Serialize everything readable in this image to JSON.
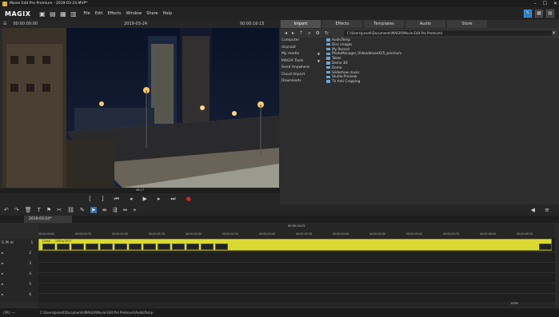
{
  "titlebar": {
    "title": "Movie Edit Pro Premium - 2019-03-24.MVP*",
    "minimize": "–",
    "maximize": "☐",
    "close": "✕"
  },
  "menubar": {
    "logo": "MAGIX",
    "menus": [
      "File",
      "Edit",
      "Effects",
      "Window",
      "Share",
      "Help"
    ]
  },
  "preview": {
    "timecode_left": "00:00:00:00",
    "title": "2019-03-24",
    "timecode_right": "00:00:16:15",
    "scrub_time": "06:17"
  },
  "media_pool": {
    "tabs": [
      "Import",
      "Effects",
      "Templates",
      "Audio",
      "Store"
    ],
    "path": "C:\\Users\\pnasti\\Documents\\MAGIX\\Movie Edit Pro Premium\\",
    "side_items": [
      {
        "label": "Computer",
        "chevron": false
      },
      {
        "label": "dcpnast",
        "chevron": false
      },
      {
        "label": "My media",
        "chevron": true
      },
      {
        "label": "MAGIX Tools",
        "chevron": true
      },
      {
        "label": "Send Anywhere",
        "chevron": false
      },
      {
        "label": "Cloud Import",
        "chevron": false
      },
      {
        "label": "Downloads",
        "chevron": false
      }
    ],
    "files": [
      "AudioTemp",
      "Disc images",
      "My Record",
      "PhotoManager_VideodeluxeX25_premium",
      "Takes",
      "Demo 3D",
      "Demo",
      "Slideshow music",
      "Studio-Preview",
      "TV Anti Cropping"
    ]
  },
  "timeline": {
    "tab": "2019-03-24*",
    "ruler_center": "00:00:16:15",
    "ticks": [
      "00:00:00:00",
      "00:00:00:30",
      "00:00:01:00",
      "00:00:01:30",
      "00:00:02:00",
      "00:00:02:30",
      "00:00:03:00",
      "00:00:03:30",
      "00:00:04:00",
      "00:00:04:30",
      "00:00:05:00",
      "00:00:05:30",
      "00:00:06:00",
      "00:00:06:30"
    ],
    "clip_label": "Dubai ... 1080p.MOV",
    "track_numbers": [
      "1",
      "2",
      "3",
      "4",
      "5",
      "6"
    ],
    "zoom": "100%"
  },
  "status": {
    "cpu": "CPU: —",
    "path": "C:\\Users\\pnasti\\Documents\\MAGIX\\Movie Edit Pro Premium\\AudioTemp"
  }
}
